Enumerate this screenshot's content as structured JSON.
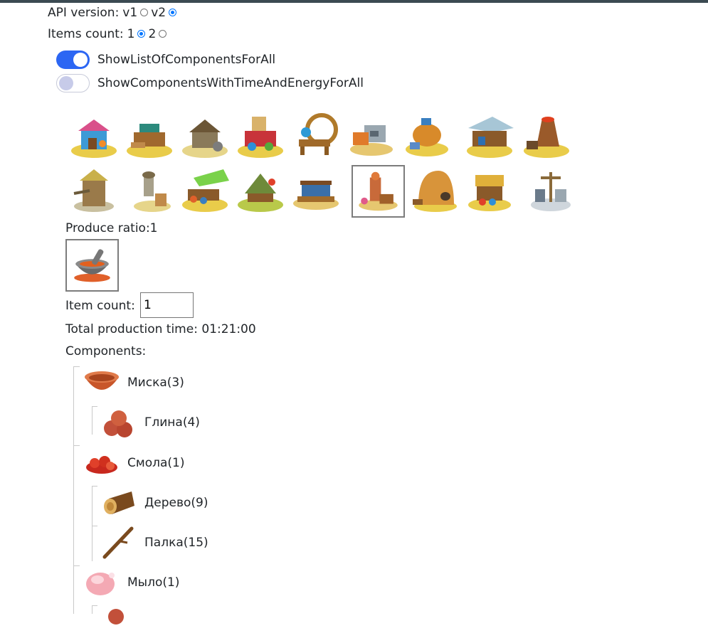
{
  "settings": {
    "api_label": "API version:",
    "api_options": [
      "v1",
      "v2"
    ],
    "api_selected": "v2",
    "items_label": "Items count:",
    "items_options": [
      "1",
      "2"
    ],
    "items_selected": "1",
    "toggles": [
      {
        "label": "ShowListOfComponentsForAll",
        "on": true
      },
      {
        "label": "ShowComponentsWithTimeAndEnergyForAll",
        "on": false
      }
    ]
  },
  "buildings": {
    "icons": [
      "paint-workshop-icon",
      "carpenter-workshop-icon",
      "loom-icon",
      "dye-house-icon",
      "spinning-wheel-icon",
      "forge-icon",
      "oven-workshop-icon",
      "market-tent-icon",
      "smelter-icon",
      "mill-icon",
      "water-tower-icon",
      "fruit-stall-icon",
      "farm-tent-icon",
      "workbench-icon",
      "pottery-workshop-icon",
      "clay-kiln-icon",
      "dye-stall-icon",
      "windmill-icon"
    ],
    "selected_index": 14
  },
  "production": {
    "ratio_text": "Produce ratio:1",
    "item_icon": "mortar-and-pestle-icon",
    "item_count_label": "Item count:",
    "item_count_value": "1",
    "total_time_text": "Total production time: 01:21:00",
    "components_label": "Components:"
  },
  "components": [
    {
      "label": "Миска(3)",
      "icon": "bowl-icon"
    },
    {
      "label": "Глина(4)",
      "icon": "clay-icon"
    },
    {
      "label": "Смола(1)",
      "icon": "resin-icon"
    },
    {
      "label": "Дерево(9)",
      "icon": "log-icon"
    },
    {
      "label": "Палка(15)",
      "icon": "stick-icon"
    },
    {
      "label": "Мыло(1)",
      "icon": "soap-icon"
    }
  ],
  "colors": {
    "accent": "#2c66f3",
    "radio": "#0075ff",
    "selection_border": "#7c7c7c",
    "topbar": "#3b4a52"
  }
}
